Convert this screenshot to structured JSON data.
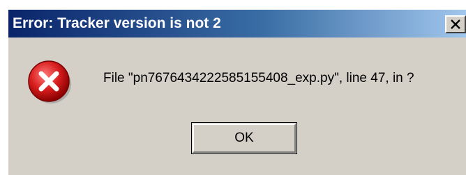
{
  "dialog": {
    "title": "Error: Tracker version is not 2",
    "message": "File \"pn7676434222585155408_exp.py\", line 47, in ?",
    "ok_label": "OK",
    "close_label": "Close",
    "icon": "error-icon"
  },
  "colors": {
    "titlebar_start": "#0a246a",
    "titlebar_end": "#a6caf0",
    "dialog_bg": "#d4d0c8",
    "error_red": "#d81e1e"
  }
}
